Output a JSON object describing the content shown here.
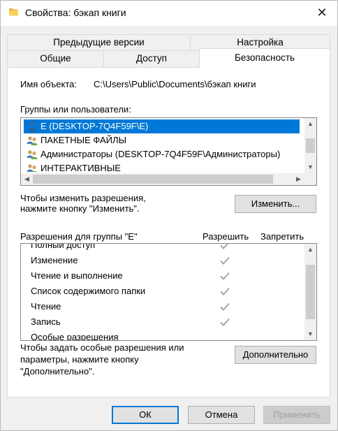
{
  "window": {
    "title": "Свойства: бэкап книги",
    "close_glyph": "✕"
  },
  "tabs": {
    "back_row": [
      "Предыдущие версии",
      "Настройка"
    ],
    "front_row": [
      "Общие",
      "Доступ",
      "Безопасность"
    ],
    "active": "Безопасность"
  },
  "security": {
    "object_name_label": "Имя объекта:",
    "object_name_value": "C:\\Users\\Public\\Documents\\бэкап книги",
    "groups_label": "Группы или пользователи:",
    "groups": [
      {
        "name": "E (DESKTOP-7Q4F59F\\E)",
        "icon": "user-icon",
        "selected": true
      },
      {
        "name": "ПАКЕТНЫЕ ФАЙЛЫ",
        "icon": "group-icon",
        "selected": false
      },
      {
        "name": "Администраторы (DESKTOP-7Q4F59F\\Администраторы)",
        "icon": "group-icon",
        "selected": false
      },
      {
        "name": "ИНТЕРАКТИВНЫЕ",
        "icon": "group-icon",
        "selected": false
      }
    ],
    "change_hint": "Чтобы изменить разрешения,\nнажмите кнопку \"Изменить\".",
    "change_hint_line1": "Чтобы изменить разрешения,",
    "change_hint_line2": "нажмите кнопку \"Изменить\".",
    "change_button": "Изменить...",
    "permissions_label": "Разрешения для группы \"E\"",
    "allow_header": "Разрешить",
    "deny_header": "Запретить",
    "permissions": [
      {
        "name": "Полный доступ",
        "allow": true,
        "deny": false
      },
      {
        "name": "Изменение",
        "allow": true,
        "deny": false
      },
      {
        "name": "Чтение и выполнение",
        "allow": true,
        "deny": false
      },
      {
        "name": "Список содержимого папки",
        "allow": true,
        "deny": false
      },
      {
        "name": "Чтение",
        "allow": true,
        "deny": false
      },
      {
        "name": "Запись",
        "allow": true,
        "deny": false
      },
      {
        "name": "Особые разрешения",
        "allow": false,
        "deny": false
      }
    ],
    "advanced_hint_line1": "Чтобы задать особые разрешения или",
    "advanced_hint_line2": "параметры, нажмите кнопку",
    "advanced_hint_line3": "\"Дополнительно\".",
    "advanced_button": "Дополнительно"
  },
  "footer": {
    "ok": "ОК",
    "cancel": "Отмена",
    "apply": "Применить"
  },
  "colors": {
    "selection": "#0078d7",
    "check_disabled": "#a6a6a6"
  }
}
